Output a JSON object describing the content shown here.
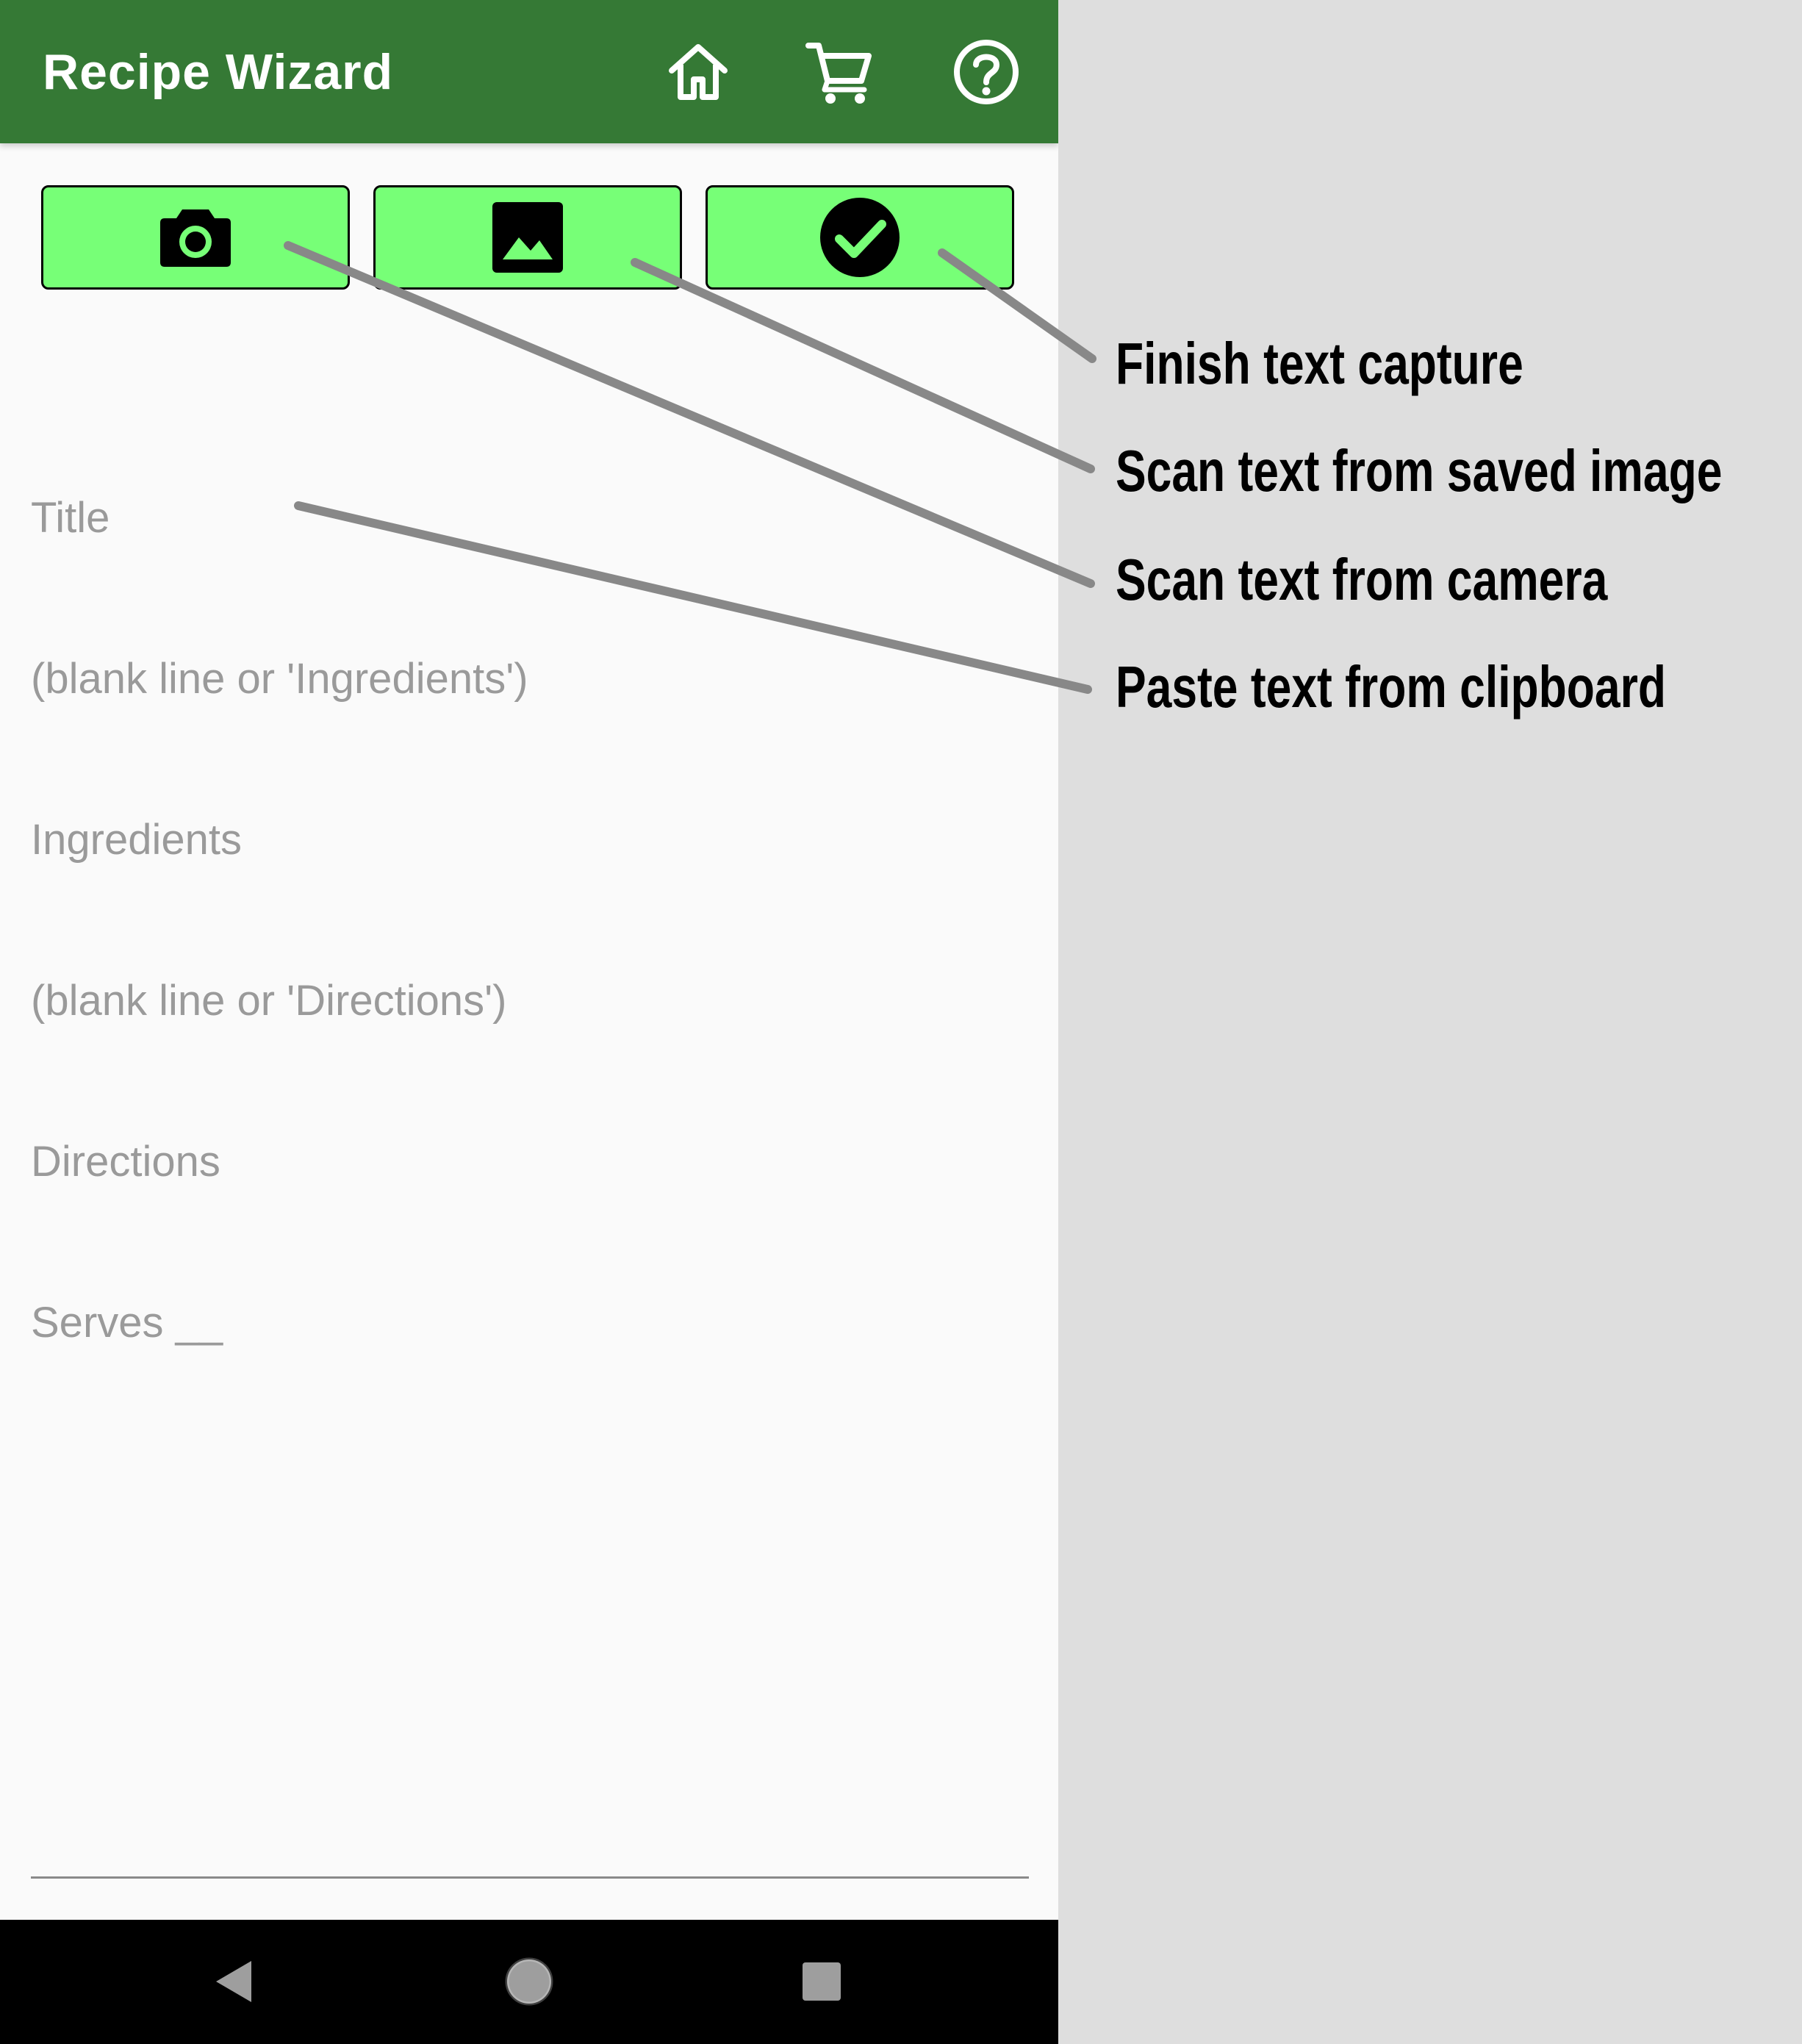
{
  "app": {
    "title": "Recipe Wizard",
    "theme_color": "#357935",
    "button_color": "#77ff77"
  },
  "appbar": {
    "icons": [
      "home-icon",
      "cart-icon",
      "help-icon"
    ]
  },
  "toolbar": {
    "buttons": [
      "camera-icon",
      "image-icon",
      "check-circle-icon"
    ]
  },
  "editor": {
    "placeholder_lines": [
      "Title",
      "(blank line or 'Ingredients')",
      "Ingredients",
      "(blank line or 'Directions')",
      "Directions",
      "Serves __"
    ]
  },
  "navbar": {
    "icons": [
      "back-icon",
      "home-circle-icon",
      "recents-icon"
    ]
  },
  "callouts": [
    "Finish text capture",
    "Scan text from saved image",
    "Scan text from camera",
    "Paste text from clipboard"
  ]
}
